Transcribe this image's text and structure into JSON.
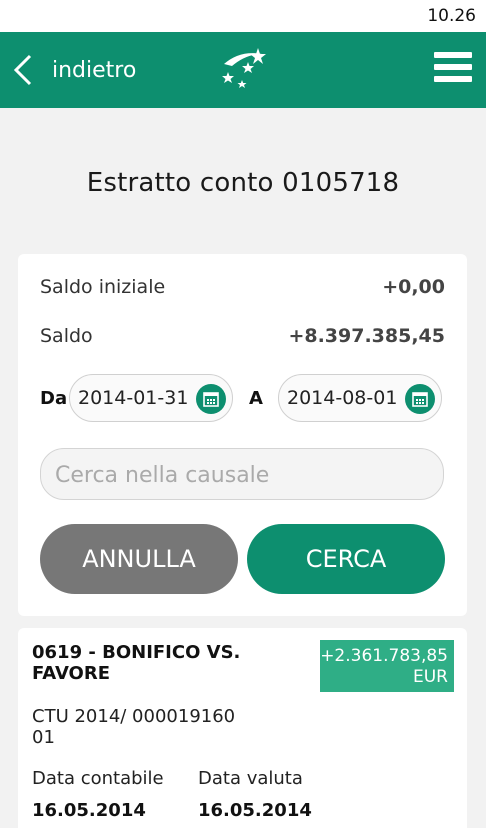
{
  "status": {
    "time": "10.26"
  },
  "appbar": {
    "back_label": "indietro",
    "logo_icon": "bnl-stars-logo-icon",
    "menu_icon": "hamburger-menu-icon"
  },
  "page": {
    "title": "Estratto conto 0105718"
  },
  "summary": {
    "saldo_iniziale_label": "Saldo iniziale",
    "saldo_iniziale_value": "+0,00",
    "saldo_label": "Saldo",
    "saldo_value": "+8.397.385,45"
  },
  "filters": {
    "from_label": "Da",
    "from_value": "2014-01-31",
    "to_label": "A",
    "to_value": "2014-08-01",
    "search_placeholder": "Cerca nella causale",
    "cancel_label": "ANNULLA",
    "search_label": "CERCA"
  },
  "transactions": [
    {
      "title": "0619 - BONIFICO VS. FAVORE",
      "amount": "+2.361.783,85",
      "currency": "EUR",
      "description": "CTU 2014/ 000019160 01",
      "accounting_date_label": "Data contabile",
      "value_date_label": "Data valuta",
      "accounting_date": "16.05.2014",
      "value_date": "16.05.2014"
    }
  ],
  "colors": {
    "brand_green": "#0d8f6f",
    "amount_green": "#2fae86",
    "cancel_gray": "#777777"
  }
}
